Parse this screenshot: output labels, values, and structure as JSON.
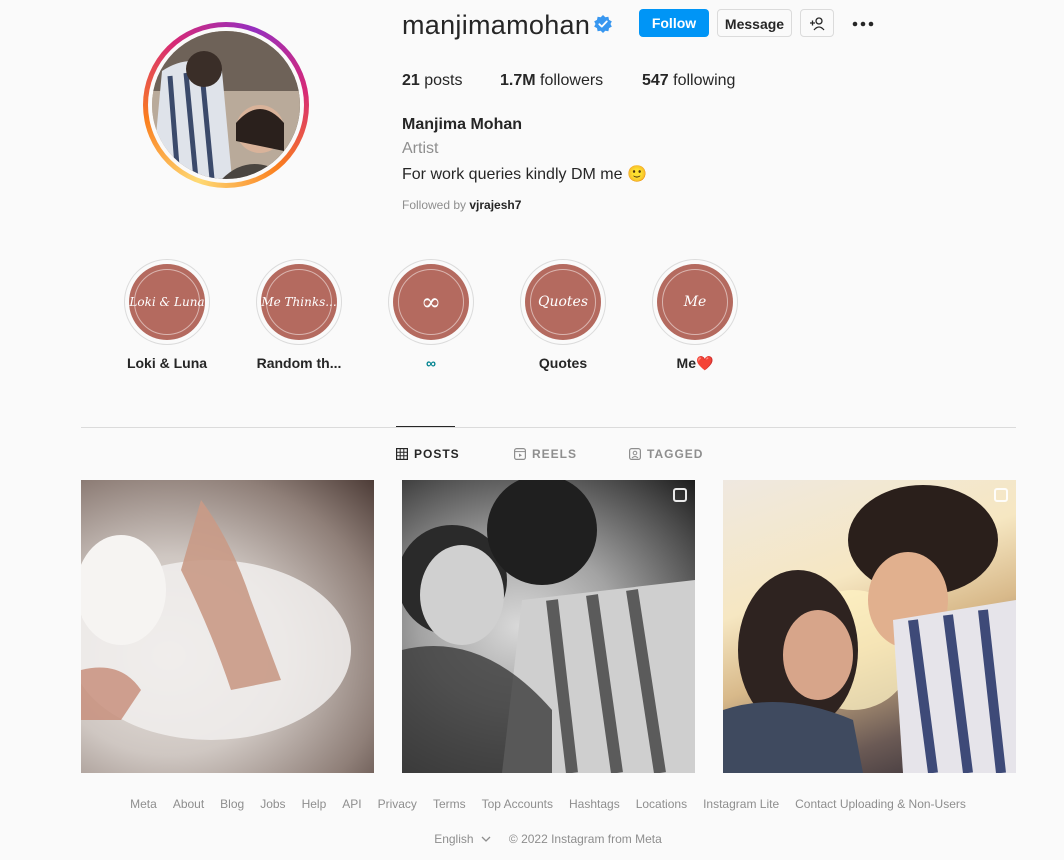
{
  "profile": {
    "username": "manjimamohan",
    "full_name": "Manjima Mohan",
    "category": "Artist",
    "bio": "For work queries kindly DM me 🙂",
    "followed_by_prefix": "Followed by",
    "followed_by_user": "vjrajesh7"
  },
  "actions": {
    "follow": "Follow",
    "message": "Message",
    "suggest_icon": "person-add-icon",
    "more_icon": "more-options-icon"
  },
  "stats": {
    "posts_count": "21",
    "posts_label": "posts",
    "followers_count": "1.7M",
    "followers_label": "followers",
    "following_count": "547",
    "following_label": "following"
  },
  "highlights": [
    {
      "cover": "Loki & Luna",
      "label": "Loki & Luna"
    },
    {
      "cover": "Me Thinks...",
      "label": "Random th..."
    },
    {
      "cover": "∞",
      "label": "∞"
    },
    {
      "cover": "Quotes",
      "label": "Quotes"
    },
    {
      "cover": "Me",
      "label": "Me❤️"
    }
  ],
  "tabs": {
    "posts": "POSTS",
    "reels": "REELS",
    "tagged": "TAGGED"
  },
  "footer": {
    "links": [
      "Meta",
      "About",
      "Blog",
      "Jobs",
      "Help",
      "API",
      "Privacy",
      "Terms",
      "Top Accounts",
      "Hashtags",
      "Locations",
      "Instagram Lite",
      "Contact Uploading & Non-Users"
    ],
    "language": "English",
    "copyright": "© 2022 Instagram from Meta"
  },
  "colors": {
    "accent": "#0095f6",
    "highlight_cover": "#b46a5f"
  }
}
